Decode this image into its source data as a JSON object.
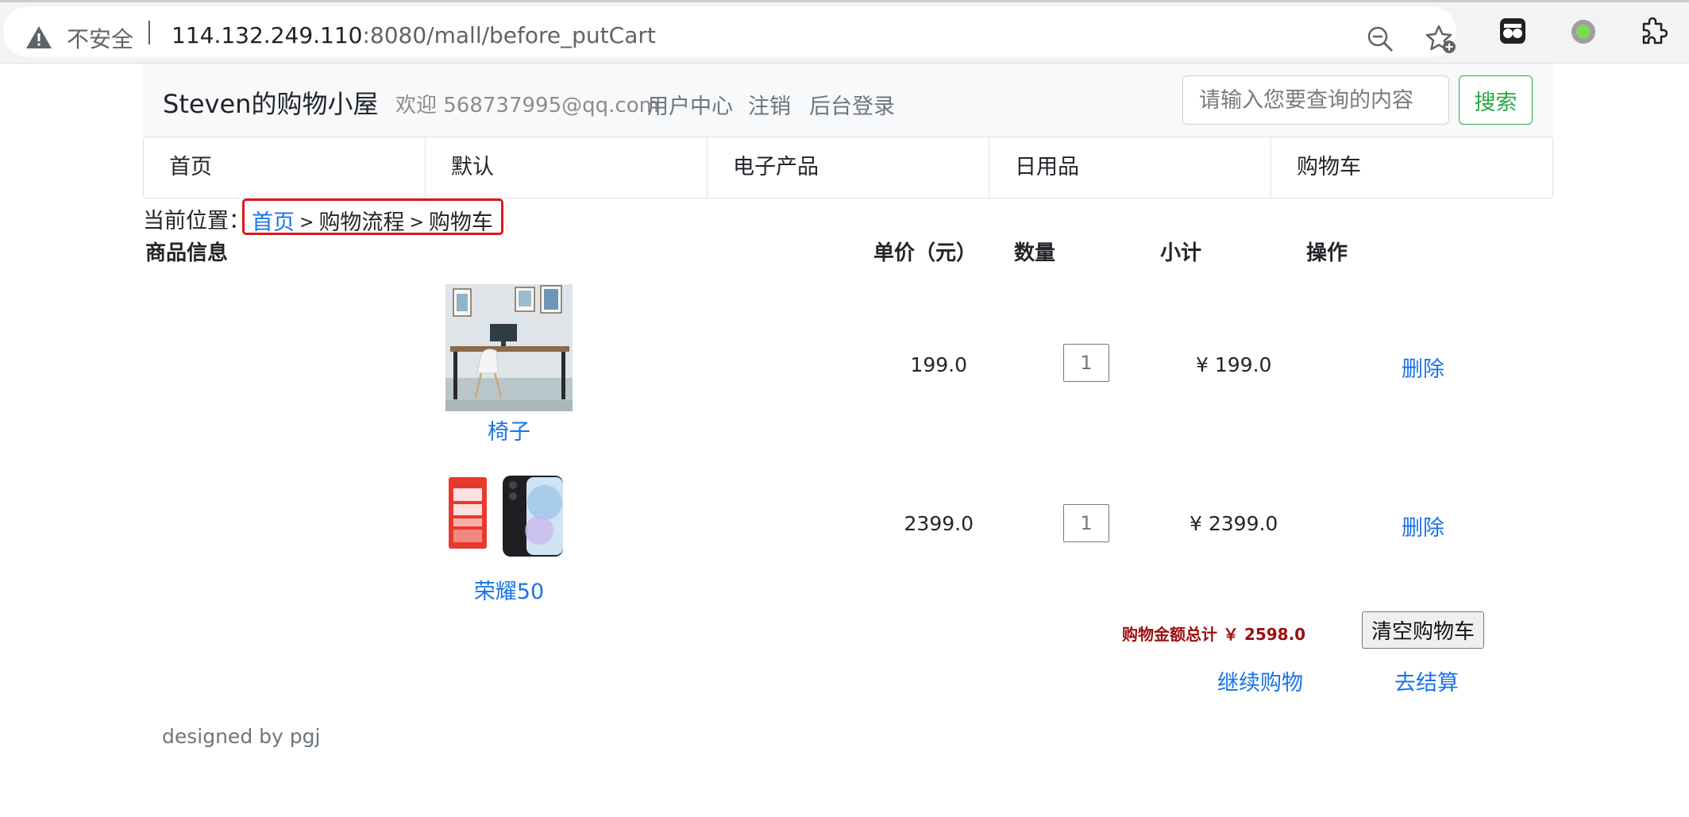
{
  "browser": {
    "security_label": "不安全",
    "url_host": "114.132.249.110",
    "url_rest": ":8080/mall/before_putCart",
    "icons": [
      "warning-icon",
      "zoom-out-icon",
      "bookmark-add-icon",
      "extension-icon",
      "profile-dot-icon",
      "puzzle-extensions-icon"
    ]
  },
  "navbar": {
    "brand": "Steven的购物小屋",
    "welcome": "欢迎 568737995@qq.com",
    "links": [
      "用户中心",
      "注销",
      "后台登录"
    ],
    "search_placeholder": "请输入您要查询的内容",
    "search_button": "搜索"
  },
  "categories": [
    "首页",
    "默认",
    "电子产品",
    "日用品",
    "购物车"
  ],
  "breadcrumb": {
    "label": "当前位置：",
    "home": "首页",
    "sep": ">",
    "step": "购物流程",
    "current": "购物车"
  },
  "table": {
    "headers": [
      "商品信息",
      "单价（元）",
      "数量",
      "小计",
      "操作"
    ]
  },
  "cart": {
    "items": [
      {
        "name": "椅子",
        "price": "199.0",
        "qty": "1",
        "subtotal": "¥ 199.0",
        "action": "删除"
      },
      {
        "name": "荣耀50",
        "price": "2399.0",
        "qty": "1",
        "subtotal": "¥ 2399.0",
        "action": "删除"
      }
    ],
    "total_text": "购物金额总计 ￥ 2598.0",
    "clear_button": "清空购物车",
    "continue_link": "继续购物",
    "checkout_link": "去结算"
  },
  "footer": {
    "text": "designed by pgj"
  },
  "colors": {
    "link": "#1a73e8",
    "success": "#28a745",
    "total": "#9b1010",
    "highlight": "#e0161b"
  }
}
